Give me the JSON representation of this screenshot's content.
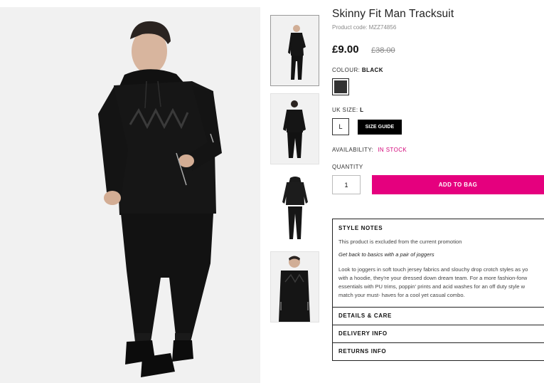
{
  "product": {
    "title": "Skinny Fit Man Tracksuit",
    "code": "Product code: MZZ74856",
    "price": "£9.00",
    "old_price": "£38.00"
  },
  "colour": {
    "label": "COLOUR:",
    "value": "BLACK",
    "swatch_color": "#333333"
  },
  "size": {
    "label": "UK SIZE:",
    "value": "L",
    "option": "L",
    "guide_label": "SIZE GUIDE"
  },
  "availability": {
    "label": "AVAILABILITY:",
    "value": "IN STOCK",
    "color": "#d3077a"
  },
  "quantity": {
    "label": "QUANTITY",
    "value": "1"
  },
  "add_to_bag": {
    "label": "ADD TO BAG",
    "color": "#e5007e"
  },
  "style_notes": {
    "heading": "STYLE NOTES",
    "promo": "This product is excluded from the current promotion",
    "tagline": "Get back to basics with a pair of joggers",
    "description": [
      "Look to joggers in soft touch jersey fabrics and slouchy drop crotch styles as yo",
      "with a hoodie, they're your dressed down dream team. For a more fashion-forw",
      "essentials with PU trims, poppin' prints and acid washes for an off duty style w",
      "match your must- haves for a cool yet casual combo."
    ]
  },
  "sections": {
    "details": "DETAILS & CARE",
    "delivery": "DELIVERY INFO",
    "returns": "RETURNS INFO"
  }
}
